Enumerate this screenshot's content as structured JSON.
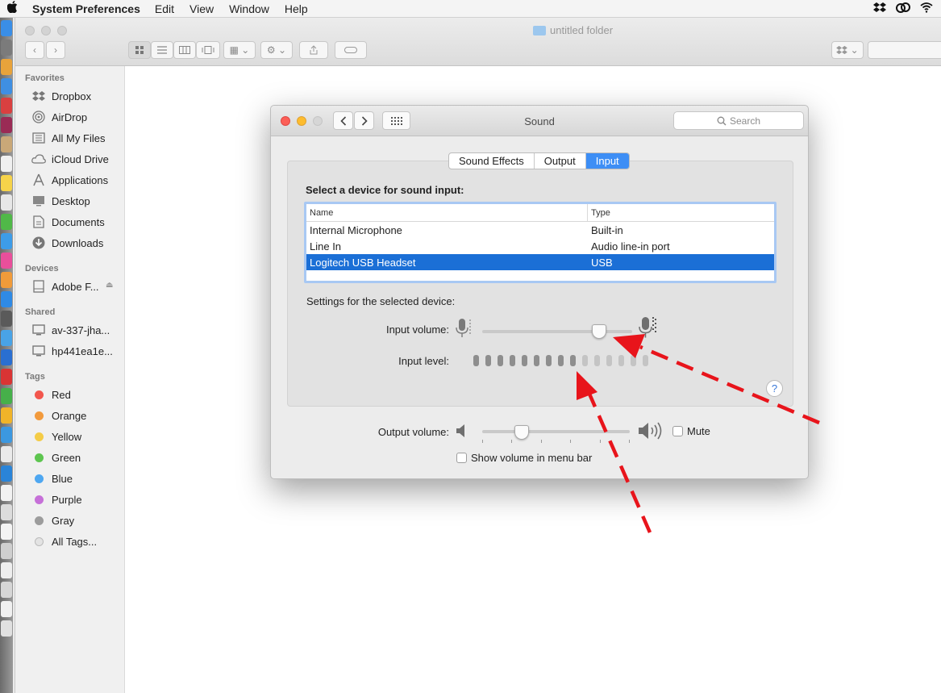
{
  "menubar": {
    "app_name": "System Preferences",
    "items": [
      "Edit",
      "View",
      "Window",
      "Help"
    ],
    "status_icons": [
      "dropbox-icon",
      "creative-cloud-icon",
      "wifi-icon"
    ]
  },
  "finder": {
    "window_title": "untitled folder",
    "sidebar": {
      "favorites_header": "Favorites",
      "favorites": [
        {
          "label": "Dropbox",
          "icon": "dropbox-icon"
        },
        {
          "label": "AirDrop",
          "icon": "airdrop-icon"
        },
        {
          "label": "All My Files",
          "icon": "all-files-icon"
        },
        {
          "label": "iCloud Drive",
          "icon": "cloud-icon"
        },
        {
          "label": "Applications",
          "icon": "applications-icon"
        },
        {
          "label": "Desktop",
          "icon": "desktop-icon"
        },
        {
          "label": "Documents",
          "icon": "documents-icon"
        },
        {
          "label": "Downloads",
          "icon": "downloads-icon"
        }
      ],
      "devices_header": "Devices",
      "devices": [
        {
          "label": "Adobe F...",
          "icon": "drive-icon"
        }
      ],
      "shared_header": "Shared",
      "shared": [
        {
          "label": "av-337-jha...",
          "icon": "computer-icon"
        },
        {
          "label": "hp441ea1e...",
          "icon": "computer-icon"
        }
      ],
      "tags_header": "Tags",
      "tags": [
        {
          "label": "Red",
          "color": "#f2564d"
        },
        {
          "label": "Orange",
          "color": "#f29a3c"
        },
        {
          "label": "Yellow",
          "color": "#f4cc47"
        },
        {
          "label": "Green",
          "color": "#5dc54f"
        },
        {
          "label": "Blue",
          "color": "#4ea7f1"
        },
        {
          "label": "Purple",
          "color": "#c670d8"
        },
        {
          "label": "Gray",
          "color": "#9c9c9c"
        },
        {
          "label": "All Tags...",
          "color": "#e3e3e3"
        }
      ]
    }
  },
  "sound": {
    "title": "Sound",
    "search_placeholder": "Search",
    "tabs": [
      {
        "label": "Sound Effects",
        "active": false
      },
      {
        "label": "Output",
        "active": false
      },
      {
        "label": "Input",
        "active": true
      }
    ],
    "device_heading": "Select a device for sound input:",
    "columns": [
      "Name",
      "Type"
    ],
    "devices": [
      {
        "name": "Internal Microphone",
        "type": "Built-in",
        "selected": false
      },
      {
        "name": "Line In",
        "type": "Audio line-in port",
        "selected": false
      },
      {
        "name": "Logitech USB Headset",
        "type": "USB",
        "selected": true
      }
    ],
    "settings_label": "Settings for the selected device:",
    "input_volume_label": "Input volume:",
    "input_volume": 0.78,
    "input_level_label": "Input level:",
    "input_level_total": 15,
    "input_level_lit": 9,
    "help_label": "?",
    "output_volume_label": "Output volume:",
    "output_volume": 0.27,
    "mute_label": "Mute",
    "mute_checked": false,
    "show_volume_label": "Show volume in menu bar",
    "show_volume_checked": false
  },
  "annotations": {
    "arrow_color": "#e8141b"
  }
}
